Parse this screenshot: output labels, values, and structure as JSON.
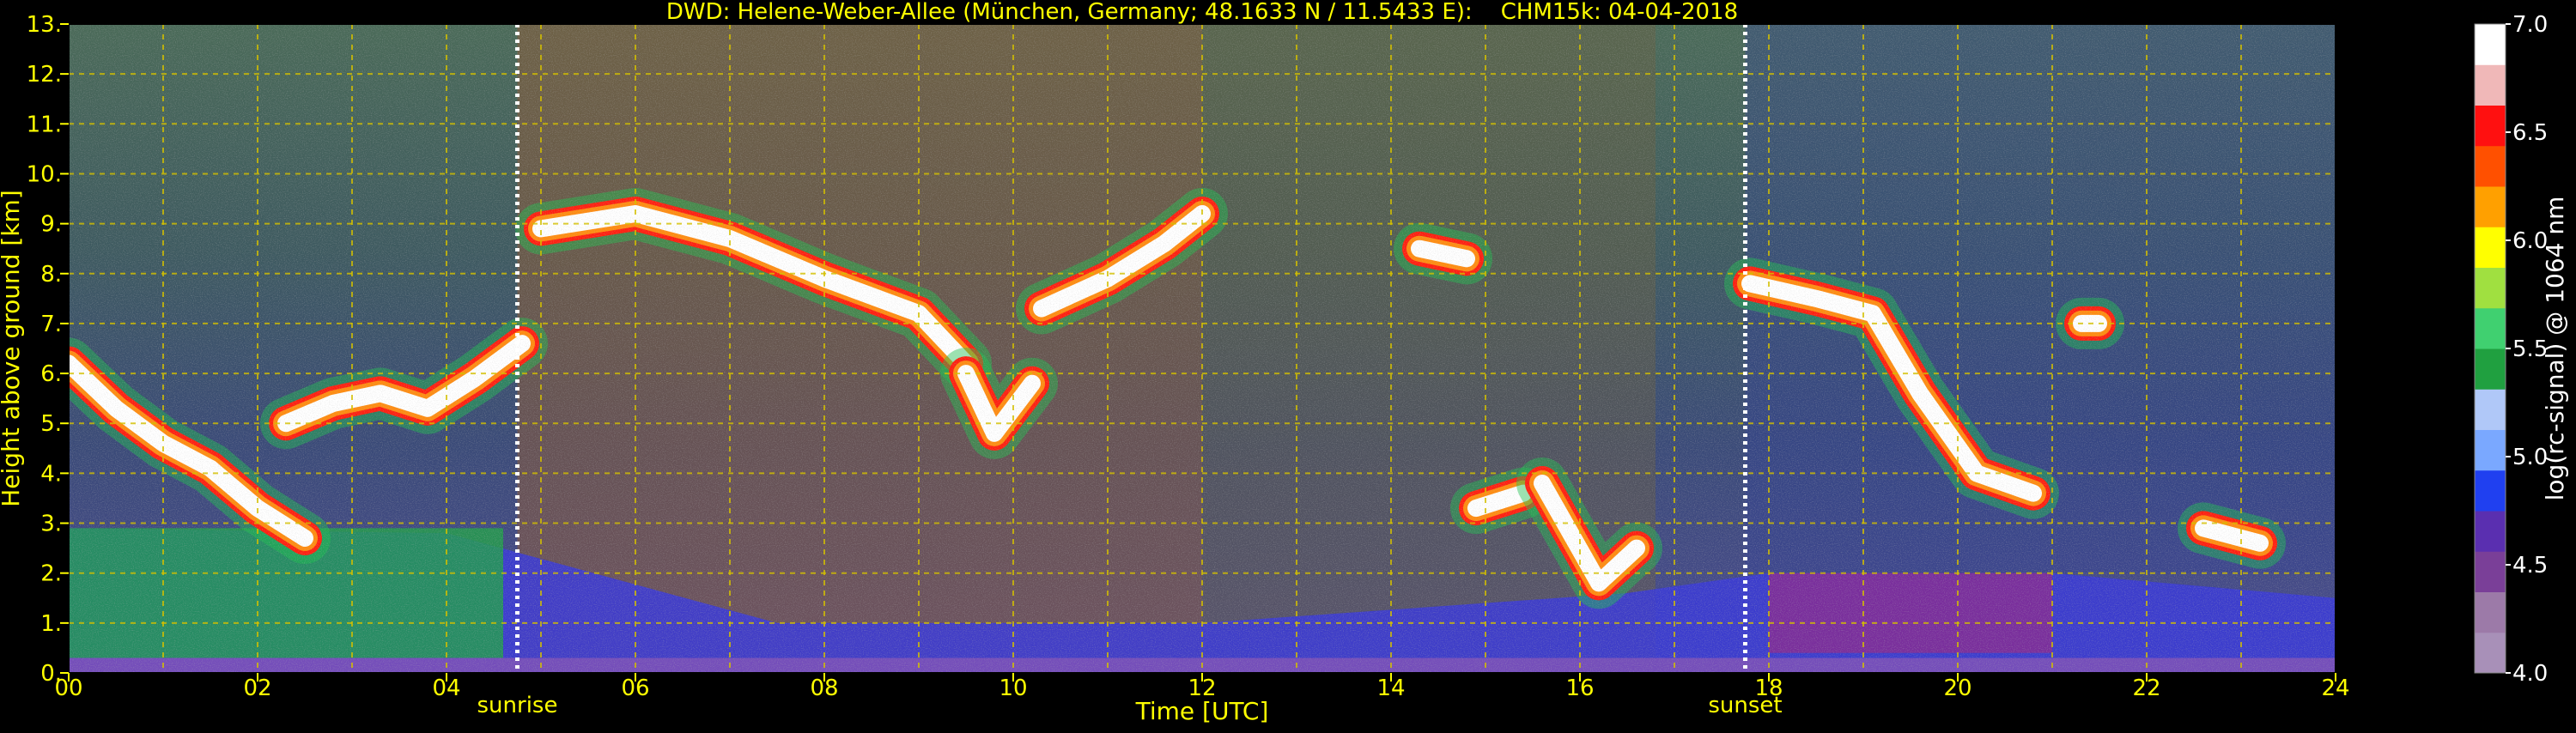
{
  "chart_data": {
    "type": "heatmap",
    "title": "DWD: Helene-Weber-Allee (München, Germany; 48.1633 N / 11.5433 E):    CHM15k: 04-04-2018",
    "xlabel": "Time [UTC]",
    "ylabel": "Height above ground [km]",
    "xlim": [
      0,
      24
    ],
    "ylim": [
      0,
      13
    ],
    "x_ticks": [
      "00",
      "02",
      "04",
      "06",
      "08",
      "10",
      "12",
      "14",
      "16",
      "18",
      "20",
      "22",
      "24"
    ],
    "y_ticks": [
      "0.",
      "1.",
      "2.",
      "3.",
      "4.",
      "5.",
      "6.",
      "7.",
      "8.",
      "9.",
      "10.",
      "11.",
      "12.",
      "13."
    ],
    "grid": true,
    "markers": [
      {
        "label": "sunrise",
        "time": 4.75
      },
      {
        "label": "sunset",
        "time": 17.75
      }
    ],
    "colorbar": {
      "label": "log(rc-signal) @ 1064 nm",
      "range": [
        4.0,
        7.0
      ],
      "ticks": [
        "4.0",
        "4.5",
        "5.0",
        "5.5",
        "6.0",
        "6.5",
        "7.0"
      ]
    },
    "cloud_layers": [
      {
        "time": [
          0.0,
          0.5,
          1.0,
          1.5,
          2.0,
          2.5
        ],
        "height": [
          6.2,
          5.3,
          4.6,
          4.1,
          3.3,
          2.7
        ]
      },
      {
        "time": [
          2.3,
          2.8,
          3.3,
          3.8,
          4.3,
          4.8
        ],
        "height": [
          5.0,
          5.4,
          5.6,
          5.3,
          5.9,
          6.6
        ]
      },
      {
        "time": [
          5.0,
          6.0,
          7.0,
          8.0,
          9.0,
          9.5
        ],
        "height": [
          8.9,
          9.2,
          8.7,
          7.9,
          7.2,
          6.2
        ]
      },
      {
        "time": [
          9.5,
          9.8,
          10.2
        ],
        "height": [
          6.0,
          4.8,
          5.8
        ]
      },
      {
        "time": [
          10.3,
          11.0,
          11.6,
          12.0
        ],
        "height": [
          7.3,
          7.9,
          8.6,
          9.2
        ]
      },
      {
        "time": [
          14.3,
          14.8
        ],
        "height": [
          8.5,
          8.3
        ]
      },
      {
        "time": [
          14.9,
          15.4
        ],
        "height": [
          3.3,
          3.6
        ]
      },
      {
        "time": [
          15.6,
          16.2,
          16.6
        ],
        "height": [
          3.8,
          1.8,
          2.5
        ]
      },
      {
        "time": [
          17.8,
          18.5,
          19.1,
          19.6,
          20.2,
          20.8
        ],
        "height": [
          7.8,
          7.5,
          7.2,
          5.6,
          4.0,
          3.6
        ]
      },
      {
        "time": [
          21.4
        ],
        "height": [
          7.0
        ]
      },
      {
        "time": [
          22.6,
          23.2
        ],
        "height": [
          2.9,
          2.6
        ]
      }
    ],
    "aerosol_layer_top_km": [
      {
        "time": 0,
        "height": 2.9
      },
      {
        "time": 4,
        "height": 2.8
      },
      {
        "time": 7.5,
        "height": 1.0
      },
      {
        "time": 12,
        "height": 1.0
      },
      {
        "time": 16.5,
        "height": 1.6
      },
      {
        "time": 18,
        "height": 2.0
      },
      {
        "time": 21,
        "height": 2.0
      },
      {
        "time": 24,
        "height": 1.5
      }
    ],
    "colors": {
      "background": "#000000",
      "text": "#ffff00",
      "grid": "#d4c000",
      "marker_line": "#ffffff",
      "colorscale": [
        "#a890b8",
        "#9c7aa8",
        "#7a3f98",
        "#5a2fb0",
        "#2040f0",
        "#7aa8ff",
        "#b0c8f8",
        "#20a040",
        "#40d070",
        "#a0e040",
        "#ffff00",
        "#ffa000",
        "#ff5000",
        "#ff1010",
        "#f0b8b8",
        "#ffffff"
      ]
    }
  }
}
